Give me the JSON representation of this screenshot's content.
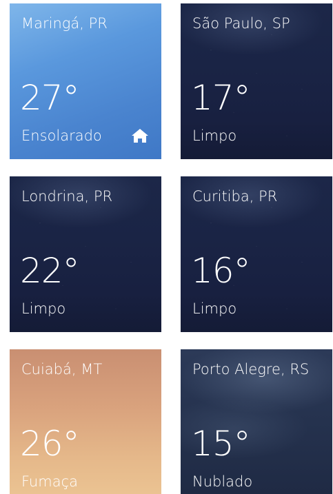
{
  "tiles": [
    {
      "city": "Maringá, PR",
      "temp": "27°",
      "condition": "Ensolarado",
      "style": "sunny",
      "home": true,
      "home_icon": "home-icon"
    },
    {
      "city": "São Paulo, SP",
      "temp": "17°",
      "condition": "Limpo",
      "style": "night"
    },
    {
      "city": "Londrina, PR",
      "temp": "22°",
      "condition": "Limpo",
      "style": "night"
    },
    {
      "city": "Curitiba, PR",
      "temp": "16°",
      "condition": "Limpo",
      "style": "night"
    },
    {
      "city": "Cuiabá, MT",
      "temp": "26°",
      "condition": "Fumaça",
      "style": "smoke"
    },
    {
      "city": "Porto Alegre, RS",
      "temp": "15°",
      "condition": "Nublado",
      "style": "cloudy"
    }
  ],
  "colors": {
    "sunny": "#4a84cf",
    "night": "#1a2445",
    "smoke": "#d9a27d",
    "cloudy": "#25324e",
    "text": "#ffffff"
  }
}
